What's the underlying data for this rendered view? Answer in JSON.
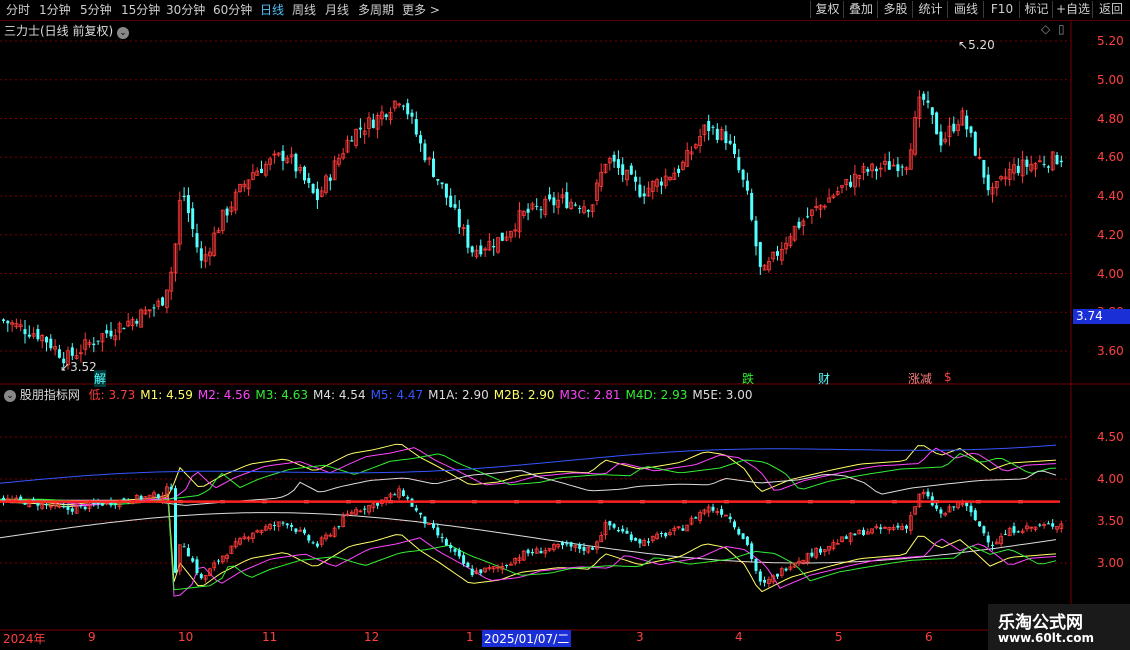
{
  "toolbar": {
    "periods": [
      "分时",
      "1分钟",
      "5分钟",
      "15分钟",
      "30分钟",
      "60分钟",
      "日线",
      "周线",
      "月线",
      "多周期",
      "更多 >"
    ],
    "active_period": "日线",
    "right_buttons": [
      "复权",
      "叠加",
      "多股",
      "统计",
      "画线",
      "F10",
      "+自选",
      "返回"
    ]
  },
  "main_chart": {
    "title": "三力士(日线 前复权)",
    "y_ticks": [
      "5.20",
      "5.00",
      "4.80",
      "4.60",
      "4.40",
      "4.20",
      "4.00",
      "3.80",
      "3.60"
    ],
    "high_label": "5.20",
    "low_label": "3.52",
    "current_price": "3.74",
    "events": [
      "解",
      "跌",
      "财",
      "涨减",
      "$"
    ]
  },
  "indicator": {
    "name": "股朋指标网",
    "values": [
      {
        "key": "低",
        "value": "3.73",
        "color": "#ff3b3b"
      },
      {
        "key": "M1",
        "value": "4.59",
        "color": "#ffff66"
      },
      {
        "key": "M2",
        "value": "4.56",
        "color": "#ff44ff"
      },
      {
        "key": "M3",
        "value": "4.63",
        "color": "#33ee33"
      },
      {
        "key": "M4",
        "value": "4.54",
        "color": "#dddddd"
      },
      {
        "key": "M5",
        "value": "4.47",
        "color": "#3355ff"
      },
      {
        "key": "M1A",
        "value": "2.90",
        "color": "#dddddd"
      },
      {
        "key": "M2B",
        "value": "2.90",
        "color": "#ffff66"
      },
      {
        "key": "M3C",
        "value": "2.81",
        "color": "#ff44ff"
      },
      {
        "key": "M4D",
        "value": "2.93",
        "color": "#33ee33"
      },
      {
        "key": "M5E",
        "value": "3.00",
        "color": "#dddddd"
      }
    ],
    "y_ticks": [
      "4.50",
      "4.00",
      "3.50",
      "3.00"
    ]
  },
  "time_axis": {
    "labels": [
      "2024年",
      "9",
      "10",
      "11",
      "12",
      "1",
      "2025/01/07/二",
      "3",
      "4",
      "5",
      "6"
    ]
  },
  "watermark": {
    "line1": "乐淘公式网",
    "line2": "www.60lt.com"
  },
  "colors": {
    "up": "#ff3b3b",
    "down": "#54ffff",
    "grid": "#7a0000",
    "axis_text": "#ff4040",
    "low_line": "#ff2020",
    "price_box": "#1a2fd6"
  }
}
